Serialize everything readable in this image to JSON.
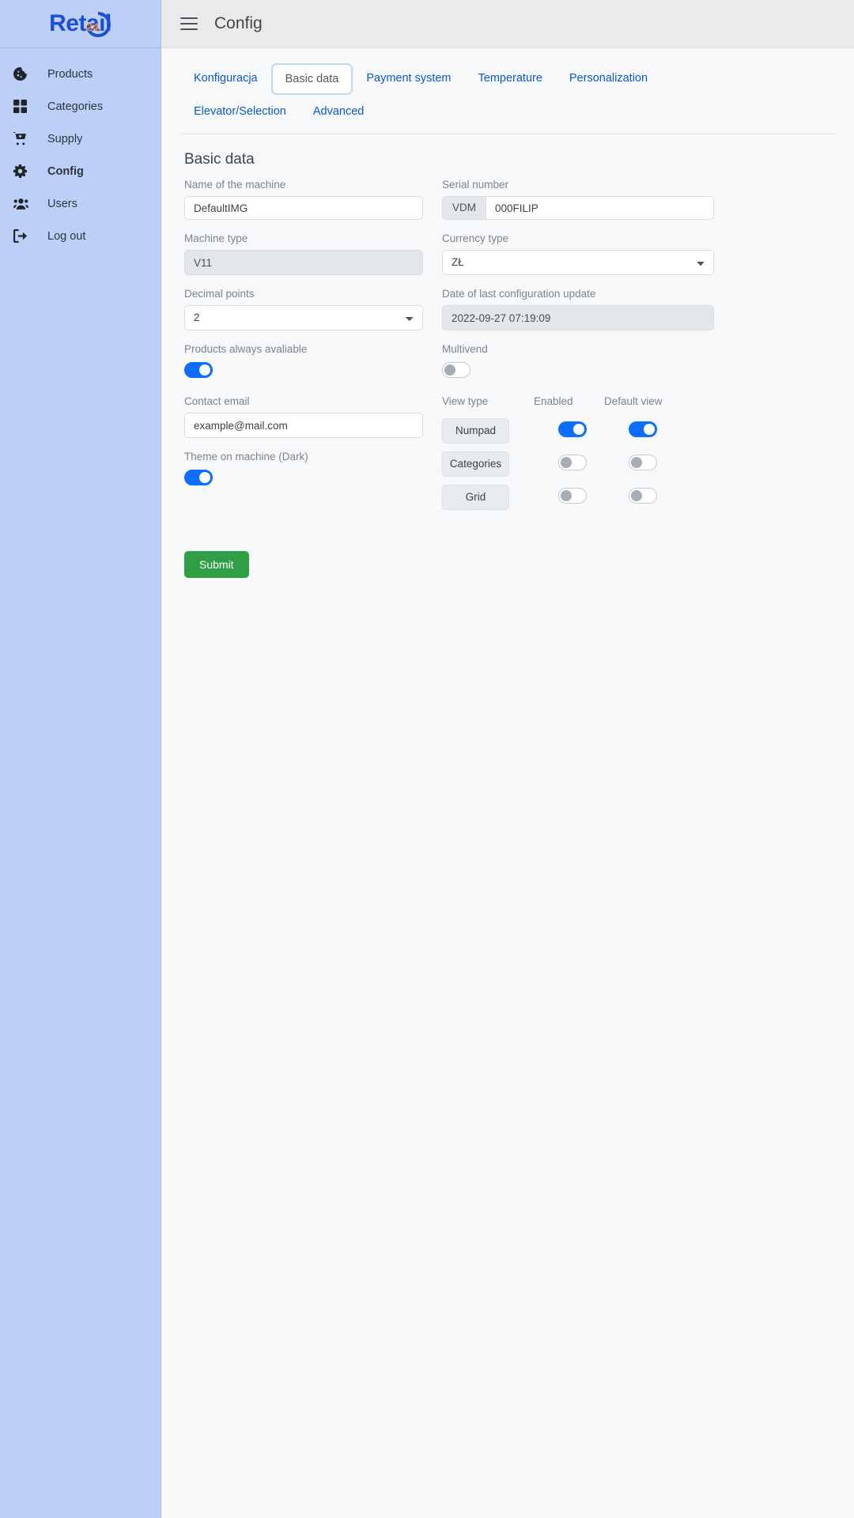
{
  "brand": {
    "name": "Retail",
    "badge": "24"
  },
  "sidebar": {
    "items": [
      {
        "label": "Products",
        "icon": "cookie-icon"
      },
      {
        "label": "Categories",
        "icon": "grid-icon"
      },
      {
        "label": "Supply",
        "icon": "cart-plus-icon"
      },
      {
        "label": "Config",
        "icon": "gear-icon"
      },
      {
        "label": "Users",
        "icon": "users-icon"
      },
      {
        "label": "Log out",
        "icon": "sign-out-icon"
      }
    ]
  },
  "topbar": {
    "title": "Config",
    "menu_icon": "hamburger-icon"
  },
  "tabs": [
    {
      "label": "Konfiguracja",
      "active": false
    },
    {
      "label": "Basic data",
      "active": true
    },
    {
      "label": "Payment system",
      "active": false
    },
    {
      "label": "Temperature",
      "active": false
    },
    {
      "label": "Personalization",
      "active": false
    },
    {
      "label": "Elevator/Selection",
      "active": false
    },
    {
      "label": "Advanced",
      "active": false
    }
  ],
  "form": {
    "section_title": "Basic data",
    "machine_name": {
      "label": "Name of the machine",
      "value": "DefaultIMG"
    },
    "serial_number": {
      "label": "Serial number",
      "prefix": "VDM",
      "value": "000FILIP"
    },
    "machine_type": {
      "label": "Machine type",
      "value": "V11"
    },
    "currency_type": {
      "label": "Currency type",
      "value": "ZŁ"
    },
    "decimal_points": {
      "label": "Decimal points",
      "value": "2"
    },
    "last_update": {
      "label": "Date of last configuration update",
      "value": "2022-09-27 07:19:09"
    },
    "products_always_available": {
      "label": "Products always avaliable",
      "state": "on"
    },
    "multivend": {
      "label": "Multivend",
      "state": "off"
    },
    "contact_email": {
      "label": "Contact email",
      "value": "example@mail.com"
    },
    "theme_on_machine": {
      "label": "Theme on machine (Dark)",
      "state": "on"
    },
    "view_type_table": {
      "headers": {
        "type": "View type",
        "enabled": "Enabled",
        "default_view": "Default view"
      },
      "rows": [
        {
          "type": "Numpad",
          "enabled": "on",
          "default_view": "on"
        },
        {
          "type": "Categories",
          "enabled": "off",
          "default_view": "off"
        },
        {
          "type": "Grid",
          "enabled": "off",
          "default_view": "off"
        }
      ]
    },
    "submit_label": "Submit"
  },
  "colors": {
    "accent": "#0d6efd",
    "submit": "#2f9e44",
    "sidebar": "#bcd0f7",
    "brand_blue": "#1a4fd6",
    "brand_orange": "#f58220"
  }
}
